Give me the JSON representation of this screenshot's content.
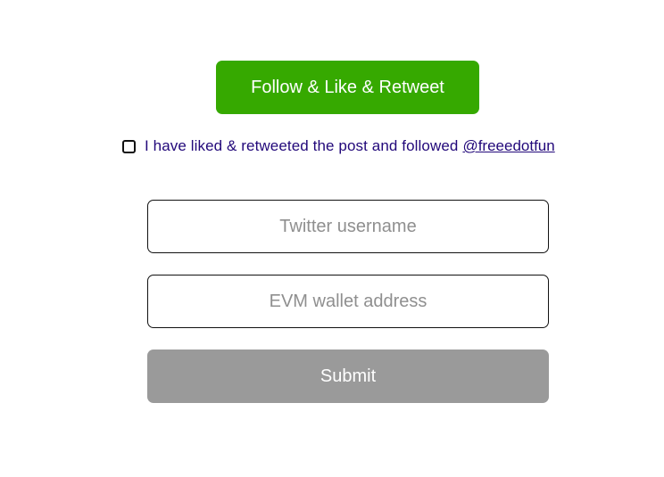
{
  "task": {
    "follow_button_label": "Follow & Like & Retweet",
    "confirm_text": "I have liked & retweeted the post and followed",
    "confirm_link": "@freeedotfun",
    "confirm_checked": false
  },
  "form": {
    "twitter_placeholder": "Twitter username",
    "twitter_value": "",
    "wallet_placeholder": "EVM wallet address",
    "wallet_value": "",
    "submit_label": "Submit"
  },
  "colors": {
    "follow_button": "#36a900",
    "submit_button_disabled": "#9a9a9a",
    "confirm_text": "#22087a"
  }
}
